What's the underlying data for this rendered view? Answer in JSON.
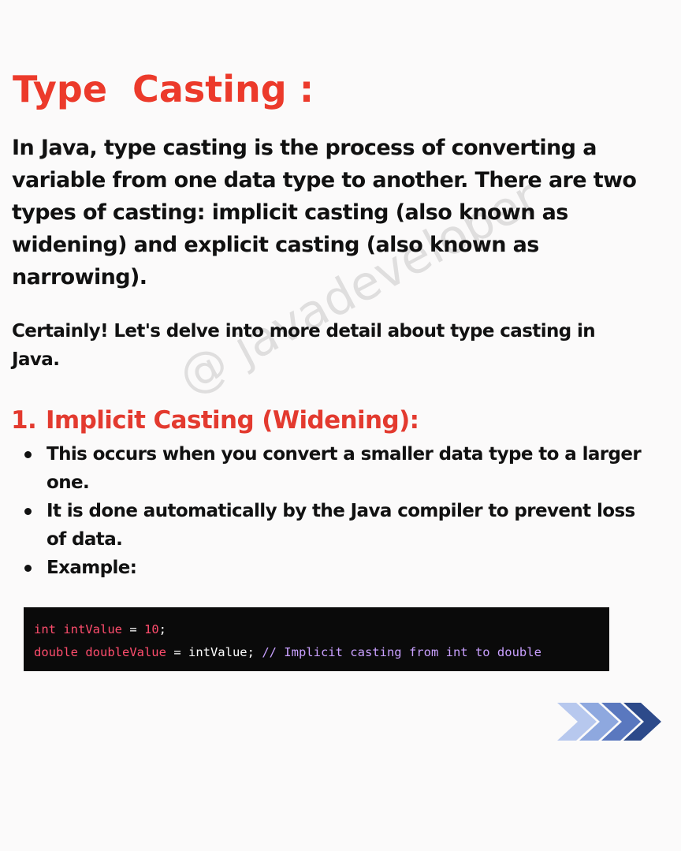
{
  "title": "Type  Casting :",
  "intro": "In Java, type casting is the process of converting a variable from one data type to another. There are two types of casting: implicit casting (also known as widening) and explicit casting (also known as narrowing).",
  "note": "Certainly! Let's delve into more detail about type casting in Java.",
  "section": {
    "number": "1.",
    "heading": "Implicit Casting (Widening):"
  },
  "bullets": [
    "This occurs when you convert a smaller data type to a larger one.",
    "It is done automatically by the Java compiler to prevent loss of data.",
    "Example:"
  ],
  "code": {
    "line1": {
      "kw": "int intValue",
      "op": " = ",
      "num": "10",
      "end": ";"
    },
    "line2": {
      "kw": "double doubleValue",
      "op": " = ",
      "rhs": "intValue;",
      "comment": " // Implicit casting from int to double"
    }
  },
  "watermark": "@ javadeveloper",
  "icons": {
    "next": "triple-chevron-right-icon"
  },
  "colors": {
    "accent": "#ec3a2b",
    "code_bg": "#0a0a0a",
    "code_keyword": "#ff4d6d",
    "code_comment": "#c9a0ff",
    "arrow_dark": "#2d4a8a",
    "arrow_light": "#aac0ea"
  }
}
